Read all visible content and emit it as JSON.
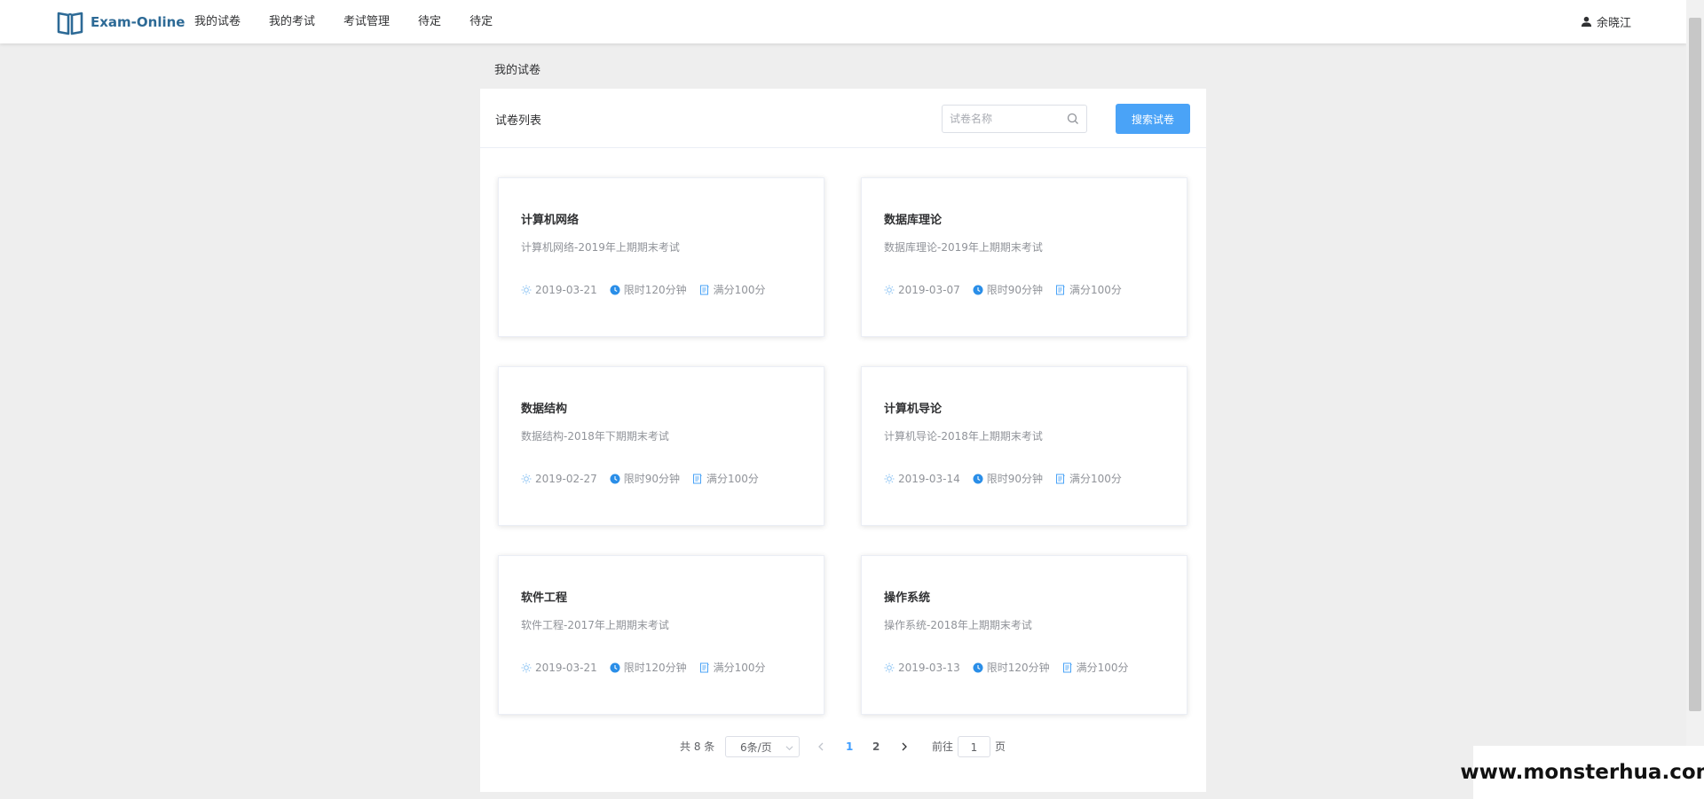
{
  "app": {
    "logo_text": "Exam-Online"
  },
  "nav": {
    "items": [
      {
        "label": "我的试卷"
      },
      {
        "label": "我的考试"
      },
      {
        "label": "考试管理"
      },
      {
        "label": "待定"
      },
      {
        "label": "待定"
      }
    ]
  },
  "user": {
    "name": "余晓江",
    "icon": "user-icon"
  },
  "breadcrumb": "我的试卷",
  "panel": {
    "title": "试卷列表",
    "search": {
      "placeholder": "试卷名称",
      "value": ""
    },
    "search_button": "搜索试卷"
  },
  "papers": [
    {
      "title": "计算机网络",
      "desc": "计算机网络-2019年上期期末考试",
      "date": "2019-03-21",
      "time": "限时120分钟",
      "score": "满分100分"
    },
    {
      "title": "数据库理论",
      "desc": "数据库理论-2019年上期期末考试",
      "date": "2019-03-07",
      "time": "限时90分钟",
      "score": "满分100分"
    },
    {
      "title": "数据结构",
      "desc": "数据结构-2018年下期期末考试",
      "date": "2019-02-27",
      "time": "限时90分钟",
      "score": "满分100分"
    },
    {
      "title": "计算机导论",
      "desc": "计算机导论-2018年上期期末考试",
      "date": "2019-03-14",
      "time": "限时90分钟",
      "score": "满分100分"
    },
    {
      "title": "软件工程",
      "desc": "软件工程-2017年上期期末考试",
      "date": "2019-03-21",
      "time": "限时120分钟",
      "score": "满分100分"
    },
    {
      "title": "操作系统",
      "desc": "操作系统-2018年上期期末考试",
      "date": "2019-03-13",
      "time": "限时120分钟",
      "score": "满分100分"
    }
  ],
  "pagination": {
    "total": "共 8 条",
    "page_size": "6条/页",
    "pages": [
      "1",
      "2"
    ],
    "current_page": "1",
    "goto_label": "前往",
    "goto_value": "1",
    "page_suffix": "页"
  },
  "watermark": "www.monsterhua.com",
  "colors": {
    "accent": "#409eff",
    "button": "#4aa3f7",
    "logo": "#2d6a96",
    "background": "#eeeeee"
  }
}
